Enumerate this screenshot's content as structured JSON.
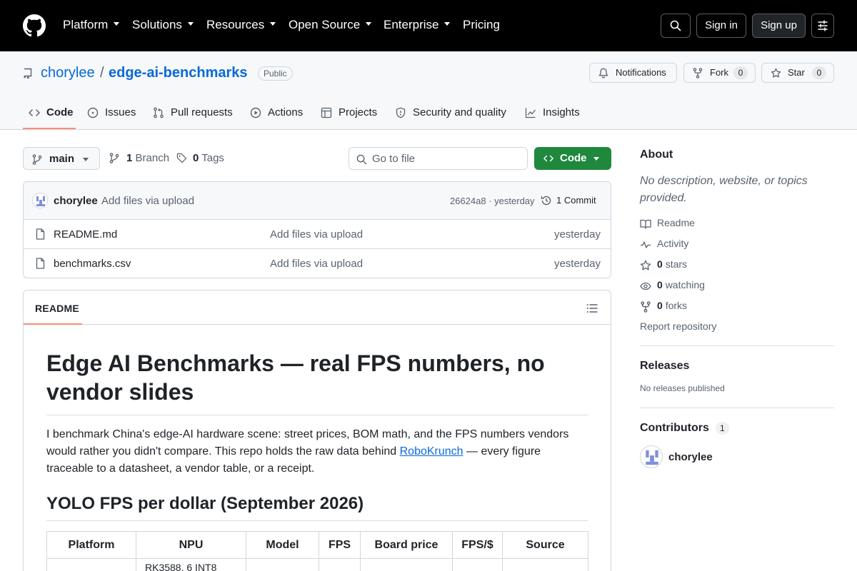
{
  "header": {
    "nav": [
      {
        "label": "Platform",
        "has_caret": true
      },
      {
        "label": "Solutions",
        "has_caret": true
      },
      {
        "label": "Resources",
        "has_caret": true
      },
      {
        "label": "Open Source",
        "has_caret": true
      },
      {
        "label": "Enterprise",
        "has_caret": true
      },
      {
        "label": "Pricing",
        "has_caret": false
      }
    ],
    "sign_in": "Sign in",
    "sign_up": "Sign up"
  },
  "repo": {
    "owner": "chorylee",
    "separator": "/",
    "name": "edge-ai-benchmarks",
    "visibility": "Public",
    "notifications_label": "Notifications",
    "fork_label": "Fork",
    "fork_count": "0",
    "star_label": "Star",
    "star_count": "0"
  },
  "tabs": [
    {
      "label": "Code",
      "icon": "code-icon",
      "active": true
    },
    {
      "label": "Issues",
      "icon": "issue-icon"
    },
    {
      "label": "Pull requests",
      "icon": "pull-request-icon"
    },
    {
      "label": "Actions",
      "icon": "play-icon"
    },
    {
      "label": "Projects",
      "icon": "table-icon"
    },
    {
      "label": "Security and quality",
      "icon": "shield-icon"
    },
    {
      "label": "Insights",
      "icon": "graph-icon"
    }
  ],
  "browser": {
    "branch": "main",
    "branch_count": "1",
    "branch_label": "Branch",
    "tag_count": "0",
    "tag_label": "Tags",
    "goto_placeholder": "Go to file",
    "code_button": "Code"
  },
  "latest_commit": {
    "author": "chorylee",
    "message": "Add files via upload",
    "sha_time": "26624a8 · yesterday",
    "commit_count": "1 Commit"
  },
  "files": [
    {
      "name": "README.md",
      "message": "Add files via upload",
      "time": "yesterday"
    },
    {
      "name": "benchmarks.csv",
      "message": "Add files via upload",
      "time": "yesterday"
    }
  ],
  "readme": {
    "tab": "README",
    "h1": "Edge AI Benchmarks — real FPS numbers, no vendor slides",
    "p_before": "I benchmark China's edge-AI hardware scene: street prices, BOM math, and the FPS numbers vendors would rather you didn't compare. This repo holds the raw data behind ",
    "p_link": "RoboKrunch",
    "p_after": " — every figure traceable to a datasheet, a vendor table, or a receipt.",
    "h2": "YOLO FPS per dollar (September 2026)",
    "table_headers": [
      "Platform",
      "NPU",
      "Model",
      "FPS",
      "Board price",
      "FPS/$",
      "Source"
    ],
    "first_row_npu_partial": "RK3588, 6 INT8"
  },
  "sidebar": {
    "about_title": "About",
    "about_desc": "No description, website, or topics provided.",
    "readme": "Readme",
    "activity": "Activity",
    "stars_count": "0",
    "stars_label": "stars",
    "watching_count": "0",
    "watching_label": "watching",
    "forks_count": "0",
    "forks_label": "forks",
    "report": "Report repository",
    "releases_title": "Releases",
    "releases_text": "No releases published",
    "contributors_title": "Contributors",
    "contributors_count": "1",
    "contributor_name": "chorylee"
  },
  "colors": {
    "topbar": "#000000",
    "link": "#0969da",
    "code_button": "#1f883d",
    "active_tab_underline": "#fd8c73"
  }
}
